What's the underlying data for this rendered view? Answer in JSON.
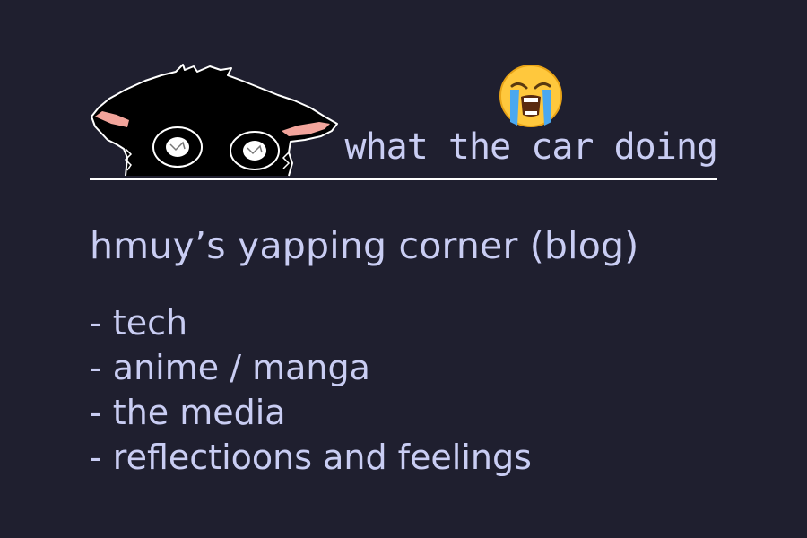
{
  "header": {
    "cat_icon": "peeking-cat-doodle",
    "emoji_icon": "loudly-crying-face-emoji",
    "caption": "what the car doing"
  },
  "blog": {
    "title": "hmuy’s yapping corner (blog)"
  },
  "topics": [
    "- tech",
    "- anime / manga",
    "- the media",
    "- reflectioons and feelings"
  ],
  "colors": {
    "background": "#1f1f2f",
    "text": "#c9cdf3",
    "line": "#ffffff",
    "cat_ear": "#f2a49b"
  }
}
